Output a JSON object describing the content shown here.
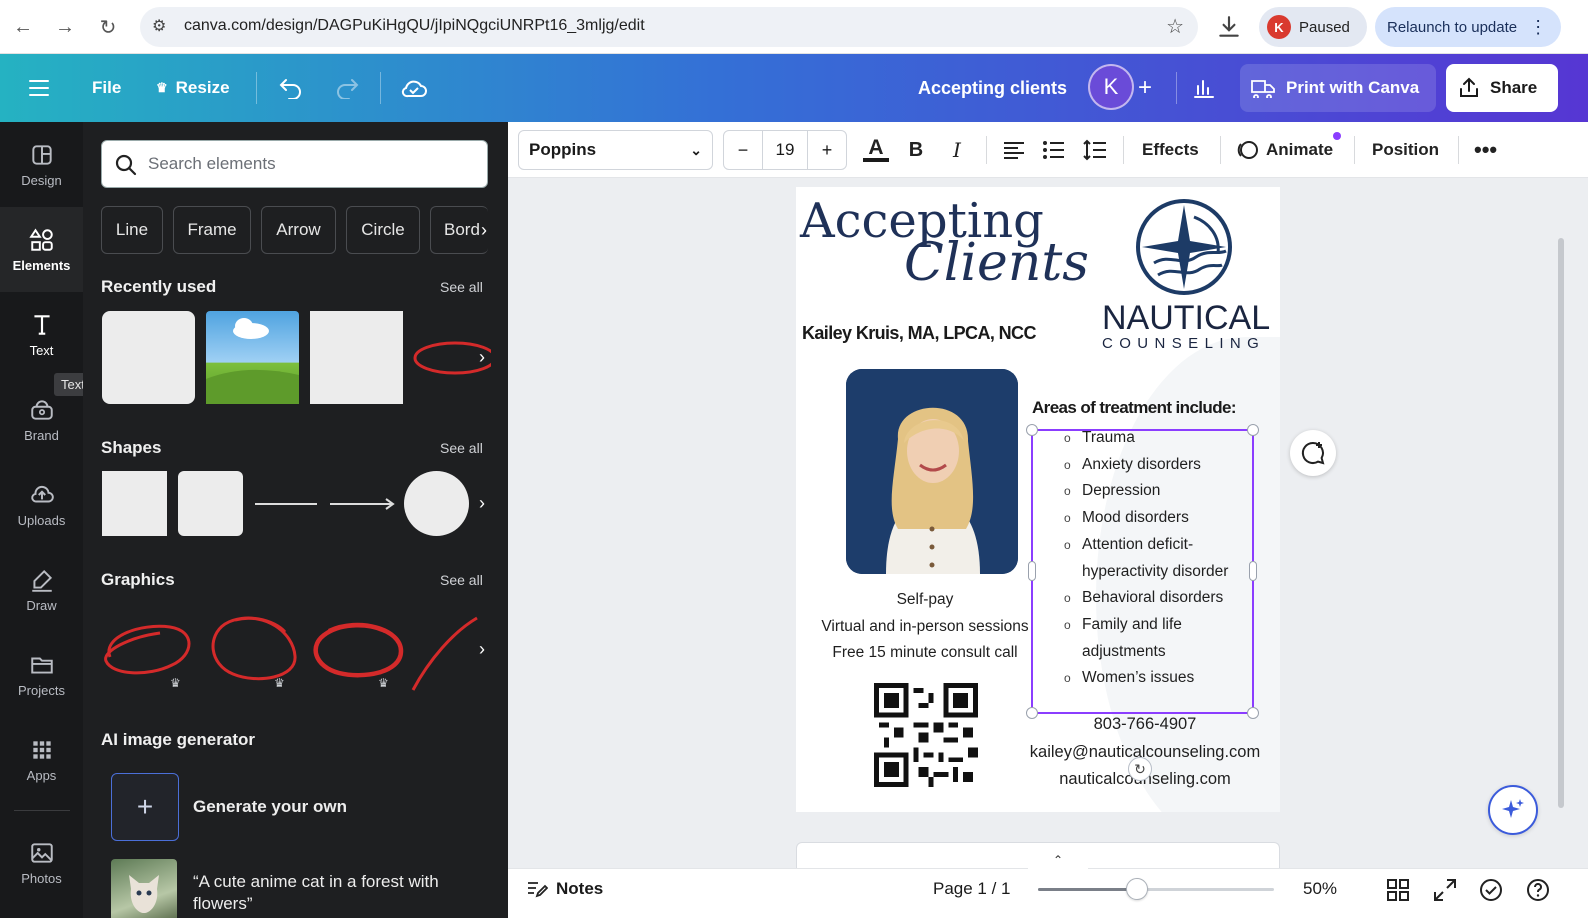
{
  "browser": {
    "url": "canva.com/design/DAGPuKiHgQU/jIpiNQgciUNRPt16_3mljg/edit",
    "profile_initial": "K",
    "paused_label": "Paused",
    "relaunch_label": "Relaunch to update"
  },
  "header": {
    "file_label": "File",
    "resize_label": "Resize",
    "doc_title": "Accepting clients",
    "avatar_initial": "K",
    "print_label": "Print with Canva",
    "share_label": "Share"
  },
  "rail": {
    "items": [
      {
        "label": "Design",
        "icon": "design-icon"
      },
      {
        "label": "Elements",
        "icon": "elements-icon"
      },
      {
        "label": "Text",
        "icon": "text-icon"
      },
      {
        "label": "Brand",
        "icon": "brand-icon"
      },
      {
        "label": "Uploads",
        "icon": "uploads-icon"
      },
      {
        "label": "Draw",
        "icon": "draw-icon"
      },
      {
        "label": "Projects",
        "icon": "projects-icon"
      },
      {
        "label": "Apps",
        "icon": "apps-icon"
      },
      {
        "label": "Photos",
        "icon": "photos-icon"
      }
    ],
    "active": "Elements",
    "tooltip": "Text"
  },
  "panel": {
    "search_placeholder": "Search elements",
    "chips": [
      "Line",
      "Frame",
      "Arrow",
      "Circle",
      "Bord"
    ],
    "recently_used_title": "Recently used",
    "shapes_title": "Shapes",
    "graphics_title": "Graphics",
    "see_all": "See all",
    "ai_title": "AI image generator",
    "generate_label": "Generate your own",
    "sample_prompt": "“A cute anime cat in a forest with flowers”"
  },
  "toolbar": {
    "font": "Poppins",
    "font_size": "19",
    "effects_label": "Effects",
    "animate_label": "Animate",
    "position_label": "Position"
  },
  "design": {
    "heading_line1": "Accepting",
    "heading_line2": "Clients",
    "logo_word": "NAUTICAL",
    "logo_sub": "COUNSELING",
    "name_line": "Kailey Kruis, MA, LPCA, NCC",
    "treatment_title": "Areas of treatment include:",
    "treatments": [
      "Trauma",
      "Anxiety disorders",
      "Depression",
      "Mood disorders",
      " Attention deficit-hyperactivity disorder",
      "Behavioral disorders",
      "Family and life adjustments",
      "Women’s issues"
    ],
    "info_lines": [
      "Self-pay",
      "Virtual and in-person sessions",
      "Free 15 minute consult call"
    ],
    "phone": "803-766-4907",
    "email": "kailey@nauticalcounseling.com",
    "website": "nauticalcounseling.com"
  },
  "footer": {
    "notes_label": "Notes",
    "page_label": "Page 1 / 1",
    "zoom_label": "50%",
    "zoom_fraction": 0.42
  },
  "colors": {
    "accent": "#8b3dff",
    "heading": "#1f3158"
  }
}
